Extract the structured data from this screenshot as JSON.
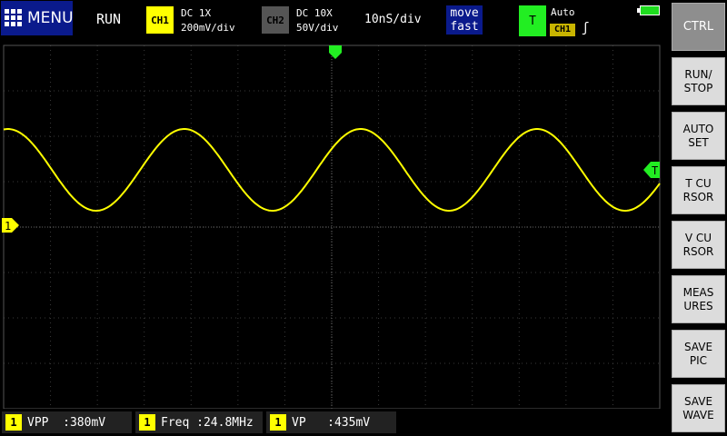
{
  "header": {
    "menu_label": "MENU",
    "run_state": "RUN",
    "ch1": {
      "tag": "CH1",
      "coupling": "DC  1X",
      "scale": "200mV/div",
      "color": "#ffff00"
    },
    "ch2": {
      "tag": "CH2",
      "coupling": "DC  10X",
      "scale": "50V/div",
      "color": "#555555"
    },
    "timebase": "10nS/div",
    "move": {
      "line1": "move",
      "line2": "fast"
    },
    "trigger": {
      "tag": "T",
      "mode": "Auto",
      "source": "CH1",
      "edge": "ʃ"
    },
    "battery_color": "#1fdc1f"
  },
  "markers": {
    "trigger_pos_color": "#22ee22",
    "trigger_level_label": "T",
    "ch1_ground_label": "1"
  },
  "trace": {
    "color": "#ffff00",
    "frequency": "24.8MHz",
    "cycles_shown": 3.72
  },
  "measurements": [
    {
      "channel": "1",
      "text": "VPP  :380mV"
    },
    {
      "channel": "1",
      "text": "Freq :24.8MHz"
    },
    {
      "channel": "1",
      "text": "VP   :435mV"
    }
  ],
  "softkeys": [
    {
      "label": "CTRL",
      "active": true
    },
    {
      "label": "RUN/\nSTOP",
      "active": false
    },
    {
      "label": "AUTO\nSET",
      "active": false
    },
    {
      "label": "T CU\nRSOR",
      "active": false
    },
    {
      "label": "V CU\nRSOR",
      "active": false
    },
    {
      "label": "MEAS\nURES",
      "active": false
    },
    {
      "label": "SAVE\nPIC",
      "active": false
    },
    {
      "label": "SAVE\nWAVE",
      "active": false
    }
  ]
}
